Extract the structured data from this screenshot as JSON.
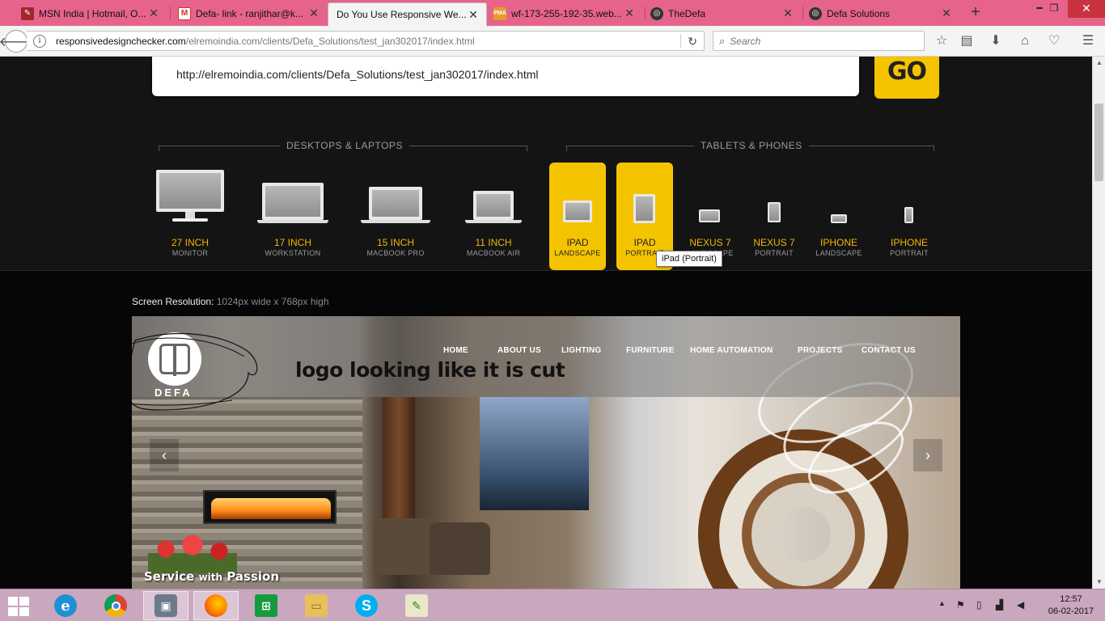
{
  "browser": {
    "tabs": [
      {
        "title": "MSN India | Hotmail, O...",
        "favicon": "msn-icon",
        "color": "#a4262c"
      },
      {
        "title": "Defa- link - ranjithar@k...",
        "favicon": "gmail-icon",
        "color": "#d93025"
      },
      {
        "title": "Do You Use Responsive We...",
        "favicon": "none",
        "active": true
      },
      {
        "title": "wf-173-255-192-35.web...",
        "favicon": "pma-icon",
        "color": "#e89b2e"
      },
      {
        "title": "TheDefa",
        "favicon": "defa-icon",
        "color": "#333333"
      },
      {
        "title": "Defa Solutions",
        "favicon": "defa-icon",
        "color": "#333333"
      }
    ],
    "url_host": "responsivedesignchecker.com",
    "url_path": "/elremoindia.com/clients/Defa_Solutions/test_jan302017/index.html",
    "search_placeholder": "Search"
  },
  "checker": {
    "url_value": "http://elremoindia.com/clients/Defa_Solutions/test_jan302017/index.html",
    "go_label": "GO",
    "groups": {
      "desktops": "DESKTOPS & LAPTOPS",
      "tablets": "TABLETS & PHONES"
    },
    "devices": [
      {
        "name": "27 INCH",
        "sub": "MONITOR"
      },
      {
        "name": "17 INCH",
        "sub": "WORKSTATION"
      },
      {
        "name": "15 INCH",
        "sub": "MACBOOK PRO"
      },
      {
        "name": "11 INCH",
        "sub": "MACBOOK AIR"
      },
      {
        "name": "IPAD",
        "sub": "LANDSCAPE",
        "active": true
      },
      {
        "name": "IPAD",
        "sub": "PORTRAIT",
        "active": true
      },
      {
        "name": "NEXUS 7",
        "sub": "LANDSCAPE"
      },
      {
        "name": "NEXUS 7",
        "sub": "PORTRAIT"
      },
      {
        "name": "IPHONE",
        "sub": "LANDSCAPE"
      },
      {
        "name": "IPHONE",
        "sub": "PORTRAIT"
      }
    ],
    "tooltip": "iPad (Portrait)",
    "resolution_label": "Screen Resolution",
    "resolution_value": "1024px wide x 768px high"
  },
  "preview": {
    "nav": [
      "HOME",
      "ABOUT US",
      "LIGHTING",
      "FURNITURE",
      "HOME AUTOMATION",
      "PROJECTS",
      "CONTACT US"
    ],
    "logo_text": "DEFA",
    "annotation": "logo looking like it is cut",
    "tagline_main": "Service",
    "tagline_small": "with",
    "tagline_end": "Passion"
  },
  "taskbar": {
    "time": "12:57",
    "date": "06-02-2017"
  },
  "colors": {
    "tabstrip": "#e6638c",
    "accent_yellow": "#f5c400",
    "taskbar": "#c9a7bf"
  }
}
